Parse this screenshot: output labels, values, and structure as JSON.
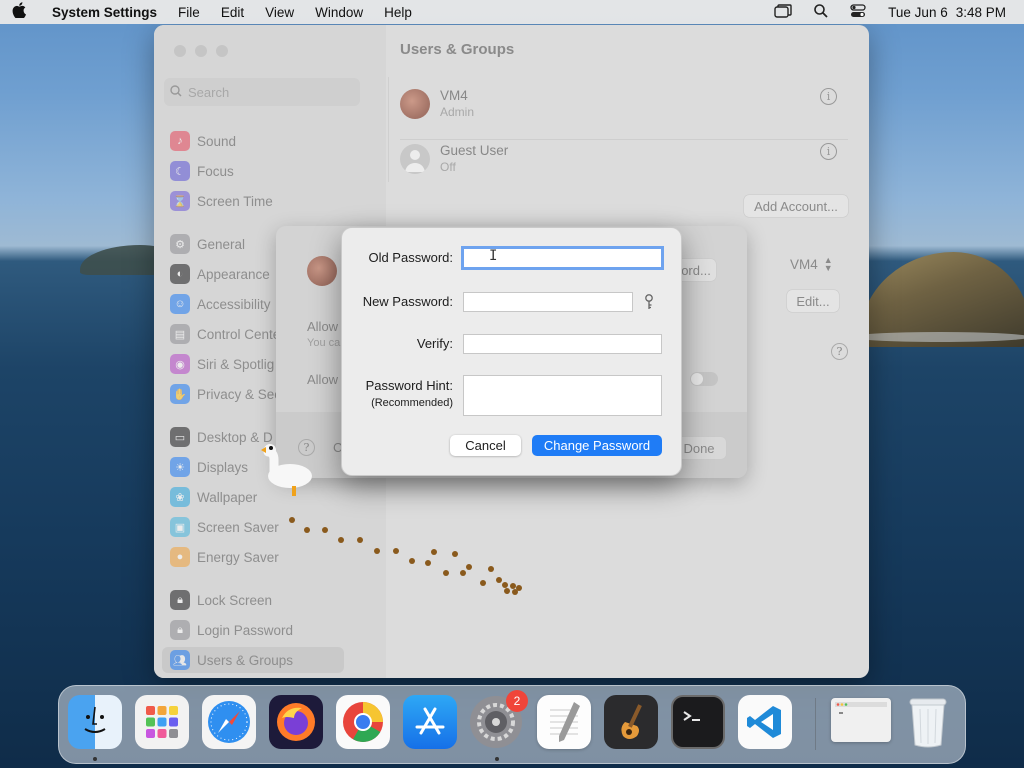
{
  "menubar": {
    "app_name": "System Settings",
    "menus": [
      "File",
      "Edit",
      "View",
      "Window",
      "Help"
    ],
    "date": "Tue Jun 6",
    "time": "3:48 PM"
  },
  "window": {
    "title": "Users & Groups",
    "search_placeholder": "Search",
    "sidebar": {
      "group1": [
        {
          "label": "Sound",
          "icon": "sound-icon",
          "color": "#e8475b"
        },
        {
          "label": "Focus",
          "icon": "moon-icon",
          "color": "#5b54d6"
        },
        {
          "label": "Screen Time",
          "icon": "hourglass-icon",
          "color": "#6d59d8"
        }
      ],
      "group2": [
        {
          "label": "General",
          "icon": "gear-icon",
          "color": "#8e8e93"
        },
        {
          "label": "Appearance",
          "icon": "appearance-icon",
          "color": "#1c1c1e"
        },
        {
          "label": "Accessibility",
          "icon": "accessibility-icon",
          "color": "#1f7cf6"
        },
        {
          "label": "Control Cente",
          "icon": "control-center-icon",
          "color": "#8e8e93"
        },
        {
          "label": "Siri & Spotlig",
          "icon": "siri-icon",
          "color": "#b648c9"
        },
        {
          "label": "Privacy & Sec",
          "icon": "hand-icon",
          "color": "#1f7cf6"
        }
      ],
      "group3": [
        {
          "label": "Desktop & D",
          "icon": "desktop-icon",
          "color": "#1c1c1e"
        },
        {
          "label": "Displays",
          "icon": "displays-icon",
          "color": "#1f7cf6"
        },
        {
          "label": "Wallpaper",
          "icon": "wallpaper-icon",
          "color": "#2aa7e0"
        },
        {
          "label": "Screen Saver",
          "icon": "screen-saver-icon",
          "color": "#45b6e0"
        },
        {
          "label": "Energy Saver",
          "icon": "bulb-icon",
          "color": "#f2a33a"
        }
      ],
      "group4": [
        {
          "label": "Lock Screen",
          "icon": "lock-icon",
          "color": "#1c1c1e"
        },
        {
          "label": "Login Password",
          "icon": "lock-icon",
          "color": "#8e8e93"
        },
        {
          "label": "Users & Groups",
          "icon": "users-icon",
          "color": "#1f7cf6"
        }
      ]
    },
    "users": [
      {
        "name": "VM4",
        "role": "Admin"
      },
      {
        "name": "Guest User",
        "role": "Off"
      }
    ],
    "add_account_label": "Add Account...",
    "autologin_value": "VM4",
    "edit_label": "Edit...",
    "help_label": "?"
  },
  "sheet": {
    "allow_label_1": "Allow",
    "allow_sub_1": "You ca",
    "allow_label_2": "Allow",
    "change_password_partial": "ord...",
    "help_label": "?",
    "c_partial": "C",
    "done_label": "Done"
  },
  "dialog": {
    "old_password_label": "Old Password:",
    "new_password_label": "New Password:",
    "verify_label": "Verify:",
    "hint_label": "Password Hint:",
    "hint_sub": "(Recommended)",
    "old_password_value": "",
    "new_password_value": "",
    "verify_value": "",
    "hint_value": "",
    "cancel_label": "Cancel",
    "change_label": "Change Password"
  },
  "dock": {
    "apps": [
      "Finder",
      "Launchpad",
      "Safari",
      "Firefox",
      "Chrome",
      "App Store",
      "System Settings",
      "TextEdit",
      "GarageBand",
      "Terminal",
      "Visual Studio Code"
    ],
    "settings_badge": "2"
  }
}
